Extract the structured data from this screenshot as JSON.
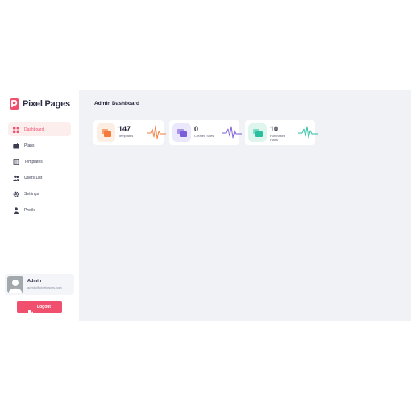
{
  "brand": {
    "name_part1": "Pixel",
    "name_part2": "Pages"
  },
  "sidebar": {
    "items": [
      {
        "label": "Dashboard",
        "icon": "grid-icon",
        "active": true
      },
      {
        "label": "Plans",
        "icon": "briefcase-icon",
        "active": false
      },
      {
        "label": "Templates",
        "icon": "document-icon",
        "active": false
      },
      {
        "label": "Users List",
        "icon": "users-icon",
        "active": false
      },
      {
        "label": "Settings",
        "icon": "gear-icon",
        "active": false
      },
      {
        "label": "Profile",
        "icon": "user-icon",
        "active": false
      }
    ]
  },
  "user": {
    "name": "Admin",
    "email": "admin@pixelpages.com"
  },
  "logout": {
    "label": "Logout",
    "icon": "logout-icon"
  },
  "main": {
    "title": "Admin Dashboard",
    "cards": [
      {
        "value": "147",
        "label": "Templates",
        "icon": "cards-icon",
        "color": "#f37a3a",
        "bg": "#fdeee4"
      },
      {
        "value": "0",
        "label": "Created Sites",
        "icon": "cards-icon",
        "color": "#7a5bd9",
        "bg": "#ece8fb"
      },
      {
        "value": "10",
        "label": "Purchased Plans",
        "icon": "cards-icon",
        "color": "#2bbfa0",
        "bg": "#dff6ef"
      }
    ]
  },
  "colors": {
    "accent": "#f0506e",
    "background": "#f1f2f6"
  }
}
